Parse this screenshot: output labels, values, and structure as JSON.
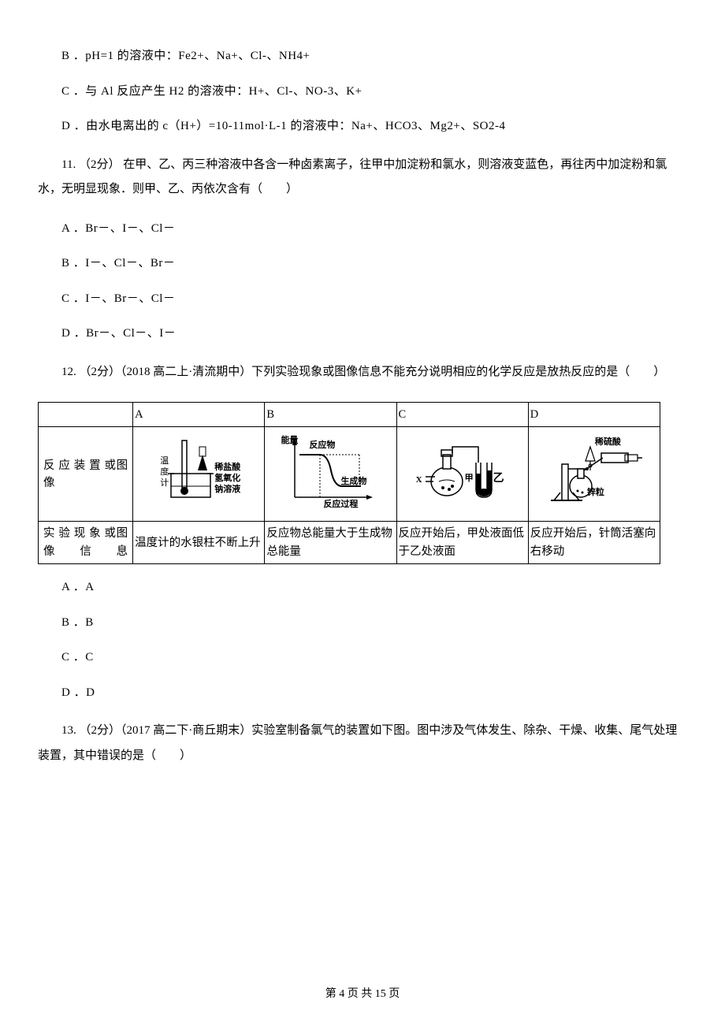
{
  "q10": {
    "optB": "B ．pH=1 的溶液中：Fe2+、Na+、Cl-、NH4+",
    "optC": "C ．与 Al 反应产生 H2 的溶液中：H+、Cl-、NO-3、K+",
    "optD": "D ．由水电离出的 c（H+）=10-11mol·L-1 的溶液中：Na+、HCO3、Mg2+、SO2-4"
  },
  "q11": {
    "stem": "11. （2分） 在甲、乙、丙三种溶液中各含一种卤素离子，往甲中加淀粉和氯水，则溶液变蓝色，再往丙中加淀粉和氯水，无明显现象．则甲、乙、丙依次含有（　　）",
    "optA": "A ．Br－、I－、Cl－",
    "optB": "B ．I－、Cl－、Br－",
    "optC": "C ．I－、Br－、Cl－",
    "optD": "D ．Br－、Cl－、I－"
  },
  "q12": {
    "stem": "12. （2分）（2018 高二上·清流期中）下列实验现象或图像信息不能充分说明相应的化学反应是放热反应的是（　　）",
    "rowHead1": "反 应 装 置 或图像",
    "rowHead2": "实 验 现 象 或图像信息",
    "colA": "A",
    "colB": "B",
    "colC": "C",
    "colD": "D",
    "diagA_l1": "温",
    "diagA_l2": "度",
    "diagA_l3": "计",
    "diagA_r1": "稀盐酸",
    "diagA_r2": "氢氧化",
    "diagA_r3": "钠溶液",
    "diagB_top": "能量",
    "diagB_react": "反应物",
    "diagB_prod": "生成物",
    "diagB_bot": "反应过程",
    "diagC_x": "X",
    "diagC_jia": "甲",
    "diagC_yi": "乙",
    "diagD_top": "稀硫酸",
    "diagD_bot": "锌粒",
    "infoA": "温度计的水银柱不断上升",
    "infoB": "反应物总能量大于生成物总能量",
    "infoC": "反应开始后，甲处液面低于乙处液面",
    "infoD": "反应开始后，针筒活塞向右移动",
    "optA": "A ．A",
    "optB": "B ．B",
    "optC": "C ．C",
    "optD": "D ．D"
  },
  "q13": {
    "stem": "13. （2分）（2017 高二下·商丘期末）实验室制备氯气的装置如下图。图中涉及气体发生、除杂、干燥、收集、尾气处理装置，其中错误的是（　　）"
  },
  "footer": "第 4 页 共 15 页"
}
